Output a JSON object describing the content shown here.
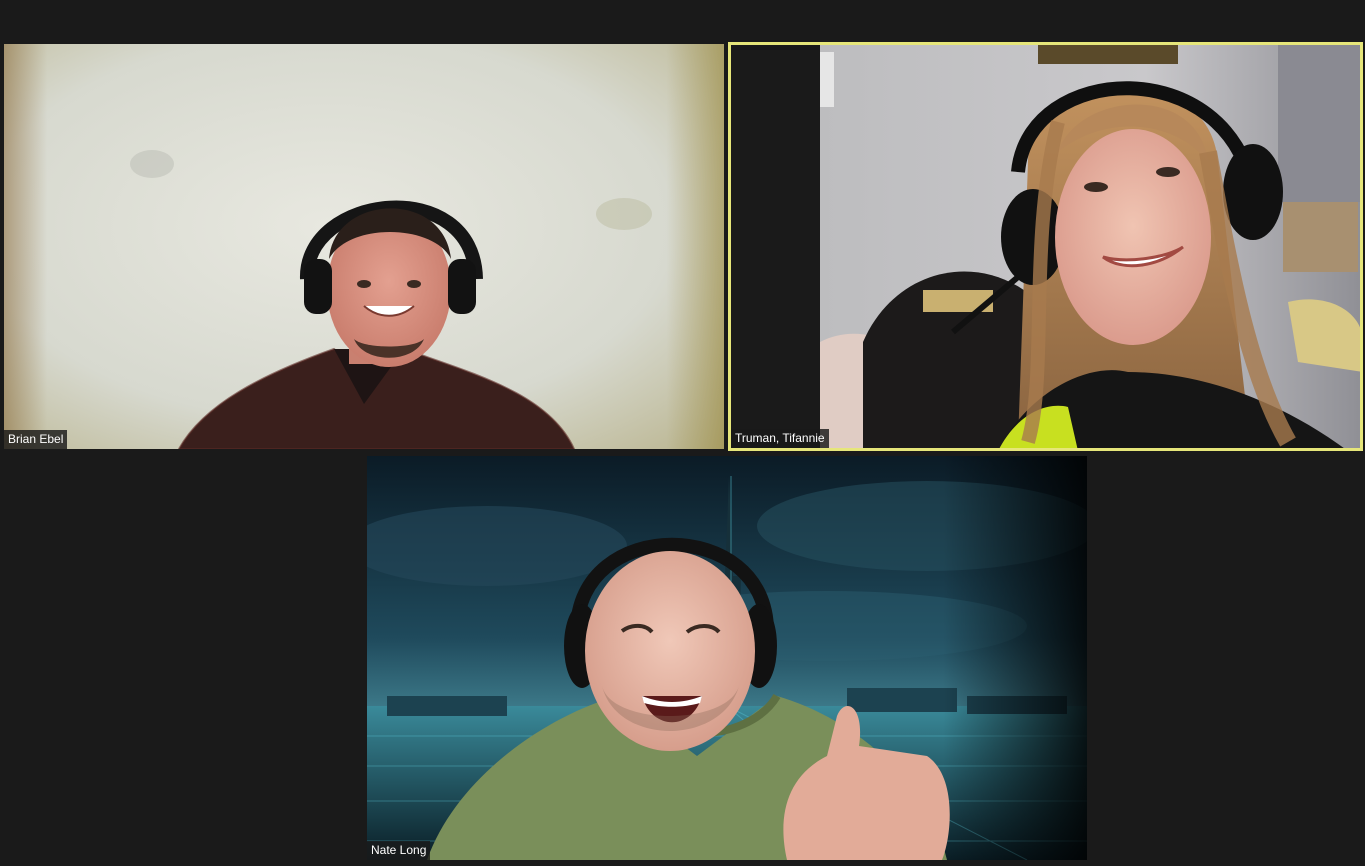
{
  "meeting": {
    "view": "gallery",
    "active_speaker": "Truman, Tifannie",
    "participants": [
      {
        "name": "Brian Ebel",
        "has_headphones": true,
        "background": "room-wall"
      },
      {
        "name": "Truman, Tifannie",
        "has_headphones": true,
        "background": "living-room",
        "active_speaker": true
      },
      {
        "name": "Nate Long",
        "has_headphones": true,
        "background": "virtual-city-night"
      }
    ]
  },
  "colors": {
    "app_background": "#1a1a1a",
    "active_speaker_border": "#e6e67a",
    "name_tag_text": "#ffffff"
  }
}
